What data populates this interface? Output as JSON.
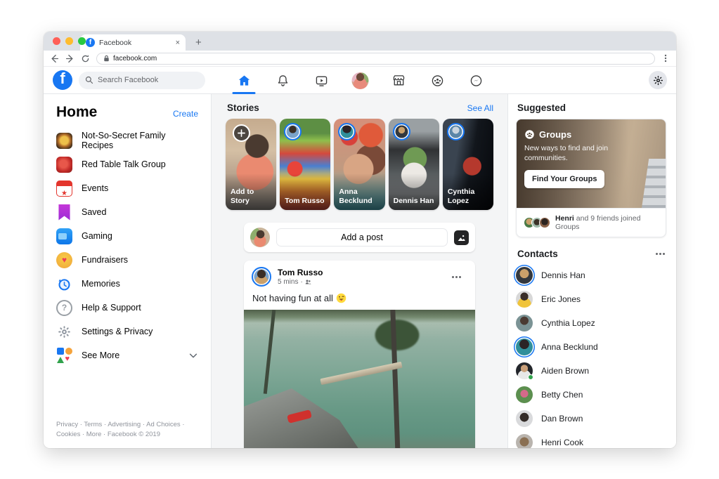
{
  "colors": {
    "accent": "#1877f2",
    "online_dot": "#31a24c",
    "traffic_red": "#ff5f57",
    "traffic_yellow": "#febc2e",
    "traffic_green": "#28c840"
  },
  "brand": {
    "logo_letter": "f"
  },
  "browser": {
    "tab_title": "Facebook",
    "tab_close": "×",
    "new_tab": "+",
    "url": "facebook.com"
  },
  "header": {
    "search_placeholder": "Search Facebook"
  },
  "sidebar": {
    "title": "Home",
    "create_label": "Create",
    "items": [
      {
        "label": "Not-So-Secret Family Recipes"
      },
      {
        "label": "Red Table Talk Group"
      },
      {
        "label": "Events"
      },
      {
        "label": "Saved"
      },
      {
        "label": "Gaming"
      },
      {
        "label": "Fundraisers"
      },
      {
        "label": "Memories"
      },
      {
        "label": "Help & Support"
      },
      {
        "label": "Settings & Privacy"
      },
      {
        "label": "See More"
      }
    ],
    "footer": "Privacy · Terms · Advertising · Ad Choices · Cookies · More · Facebook © 2019"
  },
  "stories": {
    "title": "Stories",
    "see_all_label": "See All",
    "cards": [
      {
        "name": "Add to Story",
        "type": "add"
      },
      {
        "name": "Tom Russo"
      },
      {
        "name": "Anna Becklund"
      },
      {
        "name": "Dennis Han"
      },
      {
        "name": "Cynthia Lopez"
      }
    ]
  },
  "composer": {
    "placeholder": "Add a post"
  },
  "post": {
    "author": "Tom Russo",
    "time": "5 mins",
    "meta_separator": "·",
    "text": "Not having fun at all",
    "emoji": "winking-tongue-out"
  },
  "suggested": {
    "title": "Suggested",
    "group_card": {
      "title": "Groups",
      "description": "New ways to find and join communities.",
      "button_label": "Find Your Groups",
      "activity_bold": "Henri",
      "activity_rest": " and 9 friends joined Groups"
    }
  },
  "contacts": {
    "title": "Contacts",
    "people": [
      {
        "name": "Dennis Han"
      },
      {
        "name": "Eric Jones"
      },
      {
        "name": "Cynthia Lopez"
      },
      {
        "name": "Anna Becklund"
      },
      {
        "name": "Aiden Brown"
      },
      {
        "name": "Betty Chen"
      },
      {
        "name": "Dan Brown"
      },
      {
        "name": "Henri Cook"
      }
    ]
  }
}
